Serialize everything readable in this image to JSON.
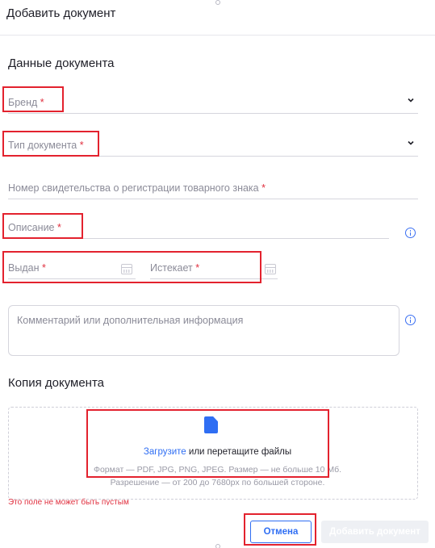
{
  "dialog": {
    "title": "Добавить документ"
  },
  "document_data": {
    "section_title": "Данные документа",
    "brand": {
      "label": "Бренд",
      "required_mark": "*",
      "icon": "chevron-down-icon"
    },
    "doc_type": {
      "label": "Тип документа",
      "required_mark": "*",
      "icon": "chevron-down-icon"
    },
    "trademark_cert": {
      "label": "Номер свидетельства о регистрации товарного знака",
      "required_mark": "*"
    },
    "description": {
      "label": "Описание",
      "required_mark": "*",
      "info_icon": "info-icon"
    },
    "issued": {
      "label": "Выдан",
      "required_mark": "*",
      "icon": "calendar-icon"
    },
    "expires": {
      "label": "Истекает",
      "required_mark": "*",
      "icon": "calendar-icon"
    },
    "comment": {
      "placeholder": "Комментарий или дополнительная информация",
      "info_icon": "info-icon"
    }
  },
  "document_copy": {
    "section_title": "Копия документа",
    "upload_link": "Загрузите",
    "upload_rest": " или перетащите файлы",
    "format_hint": "Формат — PDF, JPG, PNG, JPEG. Размер — не больше 10 Мб.",
    "resolution_hint": "Разрешение — от 200 до 7680px по большей стороне.",
    "error": "Это поле не может быть пустым"
  },
  "footer": {
    "cancel_label": "Отмена",
    "submit_label": "Добавить документ"
  },
  "colors": {
    "accent": "#2f6ef3",
    "error": "#e0303f",
    "highlight": "#e3222e",
    "disabled_button": "#eef0f4"
  }
}
